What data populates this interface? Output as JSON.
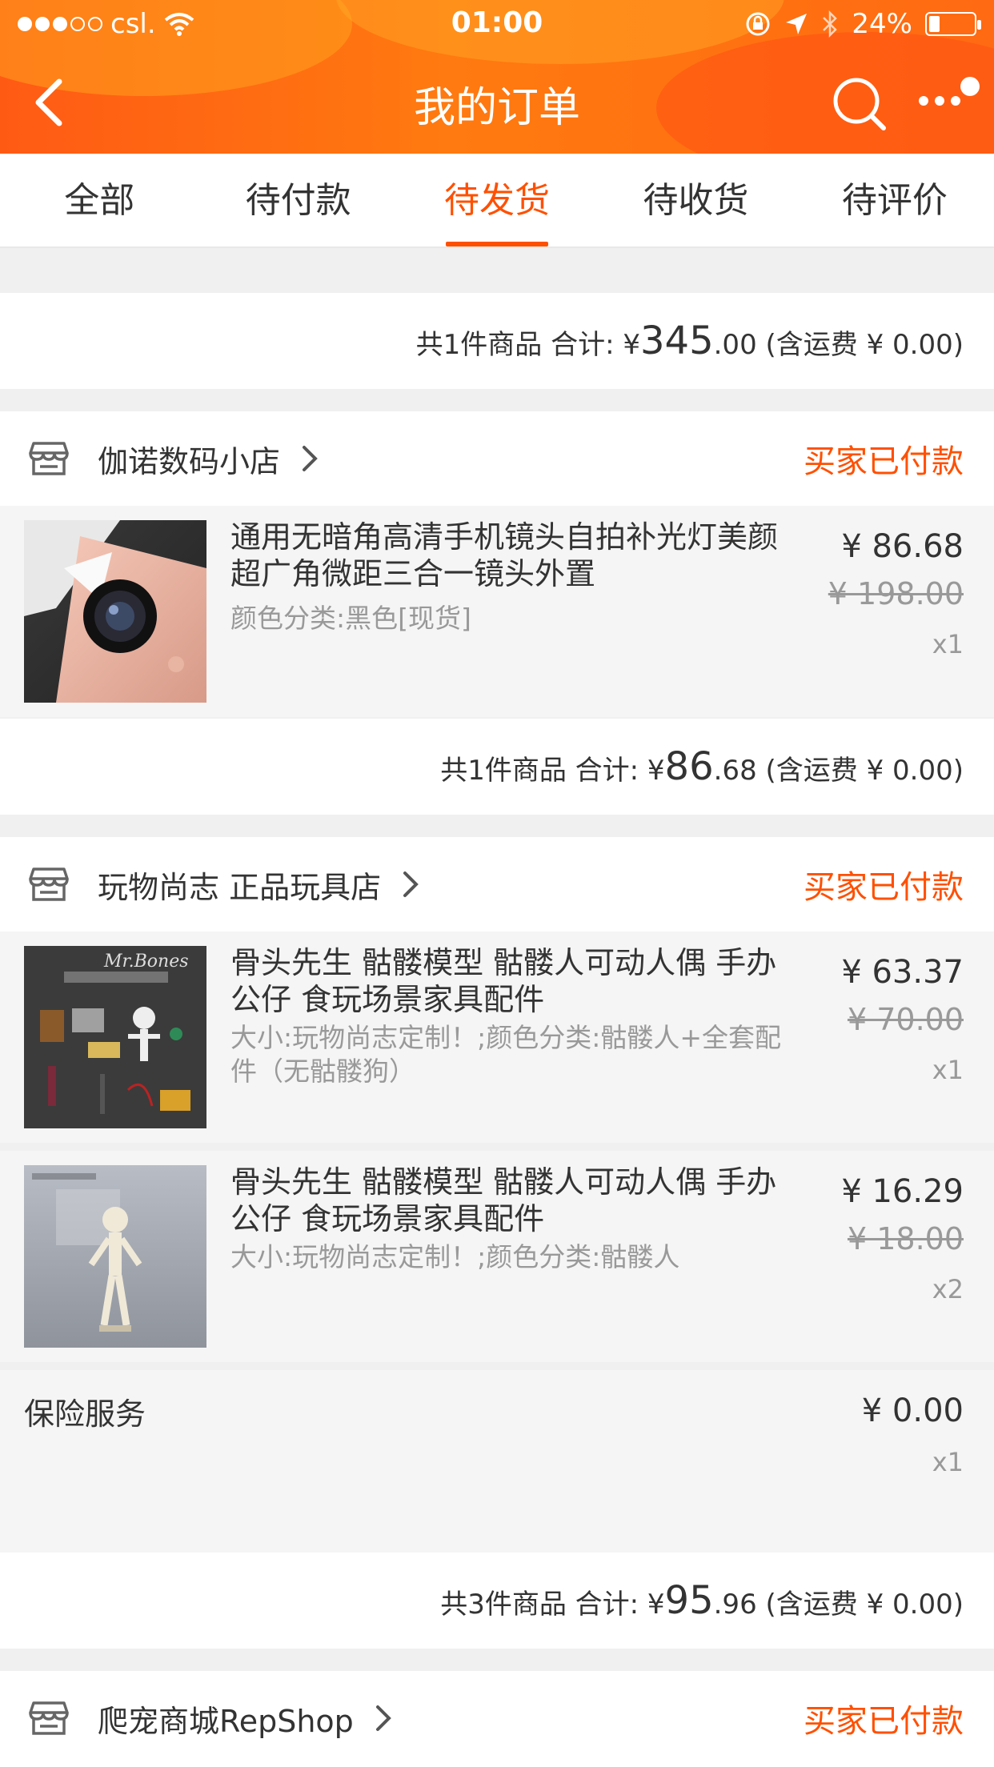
{
  "status_bar": {
    "carrier": "csl.",
    "time": "01:00",
    "battery": "24%",
    "battery_level": 0.24
  },
  "nav": {
    "title": "我的订单"
  },
  "tabs": [
    {
      "label": "全部",
      "active": false
    },
    {
      "label": "待付款",
      "active": false
    },
    {
      "label": "待发货",
      "active": true
    },
    {
      "label": "待收货",
      "active": false
    },
    {
      "label": "待评价",
      "active": false
    }
  ],
  "summary_top": {
    "prefix": "共1件商品 合计: ¥",
    "big": "345",
    "small": ".00",
    "shipping": " (含运费 ¥ 0.00)"
  },
  "orders": [
    {
      "shop": "伽诺数码小店",
      "status": "买家已付款",
      "items": [
        {
          "title": "通用无暗角高清手机镜头自拍补光灯美颜超广角微距三合一镜头外置",
          "sku": "颜色分类:黑色[现货]",
          "price": "¥ 86.68",
          "orig_price": "¥ 198.00",
          "qty": "x1"
        }
      ],
      "summary": {
        "prefix": "共1件商品 合计: ¥",
        "big": "86",
        "small": ".68",
        "shipping": " (含运费 ¥ 0.00)"
      }
    },
    {
      "shop": "玩物尚志 正品玩具店",
      "status": "买家已付款",
      "items": [
        {
          "title": "骨头先生 骷髅模型 骷髅人可动人偶 手办公仔 食玩场景家具配件",
          "sku": "大小:玩物尚志定制！;颜色分类:骷髅人+全套配件（无骷髅狗）",
          "price": "¥ 63.37",
          "orig_price": "¥ 70.00",
          "qty": "x1",
          "thumb_text": "Mr.Bones"
        },
        {
          "title": "骨头先生 骷髅模型 骷髅人可动人偶 手办公仔 食玩场景家具配件",
          "sku": "大小:玩物尚志定制！;颜色分类:骷髅人",
          "price": "¥ 16.29",
          "orig_price": "¥ 18.00",
          "qty": "x2"
        }
      ],
      "service": {
        "label": "保险服务",
        "price": "¥ 0.00",
        "qty": "x1"
      },
      "summary": {
        "prefix": "共3件商品 合计: ¥",
        "big": "95",
        "small": ".96",
        "shipping": " (含运费 ¥ 0.00)"
      }
    },
    {
      "shop": "爬宠商城RepShop",
      "status": "买家已付款"
    }
  ],
  "colors": {
    "accent": "#ff5000",
    "header": "#ff6a10",
    "muted": "#999999",
    "item_bg": "#f5f5f5"
  }
}
